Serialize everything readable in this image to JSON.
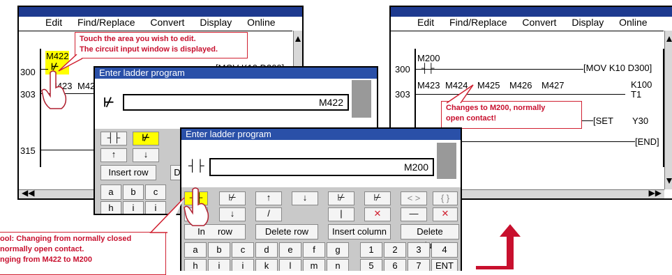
{
  "left_screen": {
    "menu": [
      "Edit",
      "Find/Replace",
      "Convert",
      "Display",
      "Online"
    ],
    "rows": [
      "300",
      "303",
      "315"
    ],
    "highlight_label": "M422",
    "contact_labels": [
      "M423",
      "M42"
    ],
    "instruction_text": "[MOV K10 D300]"
  },
  "right_screen": {
    "menu": [
      "Edit",
      "Find/Replace",
      "Convert",
      "Display",
      "Online"
    ],
    "rows": [
      "300",
      "303"
    ],
    "first_contact": "M200",
    "mov_text": "[MOV K10 D300]",
    "contacts": [
      "M423",
      "M424",
      "M425",
      "M426",
      "M427"
    ],
    "k100": "K100",
    "t1": "T1",
    "set_text": "[SET",
    "y30": "Y30",
    "end_text": "[END]"
  },
  "callouts": {
    "touch": [
      "Touch the area you wish to edit.",
      "The circuit input window is displayed."
    ],
    "changes": [
      "Changes to M200, normally",
      "open contact!"
    ],
    "tool": [
      "ool: Changing from normally closed",
      "normally open contact.",
      "nging from M422 to M200"
    ]
  },
  "dialog_back": {
    "title": "Enter ladder program",
    "field_value": "M422",
    "insert_row": "Insert row",
    "partial_key": "D",
    "letters": [
      "a",
      "b",
      "c"
    ],
    "letters2": [
      "h",
      "i",
      "i"
    ]
  },
  "dialog_front": {
    "title": "Enter ladder program",
    "field_value": "M200",
    "bracket_keys": [
      "< >",
      "{ }"
    ],
    "buttons": [
      "In",
      "row",
      "Delete row",
      "Insert column",
      "Delete column"
    ],
    "keys_row1": [
      "a",
      "b",
      "c",
      "d",
      "e",
      "f",
      "g",
      "1",
      "2",
      "3",
      "4"
    ],
    "keys_row2": [
      "h",
      "i",
      "i",
      "k",
      "l",
      "m",
      "n",
      "5",
      "6",
      "7",
      "ENT"
    ]
  },
  "colors": {
    "title_bar": "#1e3a8f",
    "highlight": "#ffff00",
    "callout_red": "#c8102e",
    "arrow": "#c8102e"
  }
}
